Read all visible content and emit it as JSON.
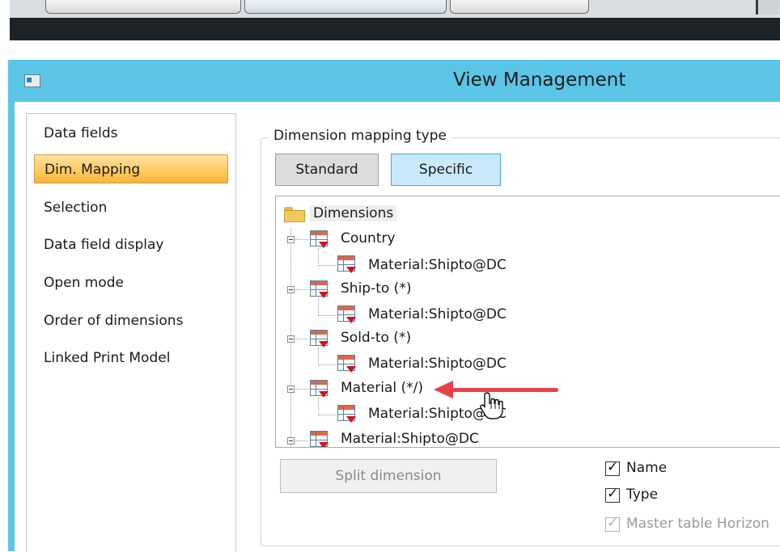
{
  "window": {
    "title": "View Management"
  },
  "nav": {
    "items": [
      {
        "label": "Data fields",
        "selected": false
      },
      {
        "label": "Dim. Mapping",
        "selected": true
      },
      {
        "label": "Selection",
        "selected": false
      },
      {
        "label": "Data field display",
        "selected": false
      },
      {
        "label": "Open mode",
        "selected": false
      },
      {
        "label": "Order of dimensions",
        "selected": false
      },
      {
        "label": "Linked Print Model",
        "selected": false
      }
    ]
  },
  "mapping": {
    "group_label": "Dimension mapping type",
    "standard_label": "Standard",
    "specific_label": "Specific",
    "active": "Specific"
  },
  "tree": {
    "root": "Dimensions",
    "nodes": [
      {
        "label": "Country",
        "child": "Material:Shipto@DC"
      },
      {
        "label": "Ship-to (*)",
        "child": "Material:Shipto@DC"
      },
      {
        "label": "Sold-to (*)",
        "child": "Material:Shipto@DC"
      },
      {
        "label": "Material (*/)",
        "child": "Material:Shipto@DC"
      },
      {
        "label": "Material:Shipto@DC"
      }
    ]
  },
  "bottom": {
    "split_label": "Split dimension",
    "name_label": "Name",
    "type_label": "Type",
    "master_label": "Master table Horizon"
  },
  "colors": {
    "titlebar": "#5bc5e8",
    "selected_nav": "#ffca62",
    "annotation_arrow": "#e8414a"
  }
}
